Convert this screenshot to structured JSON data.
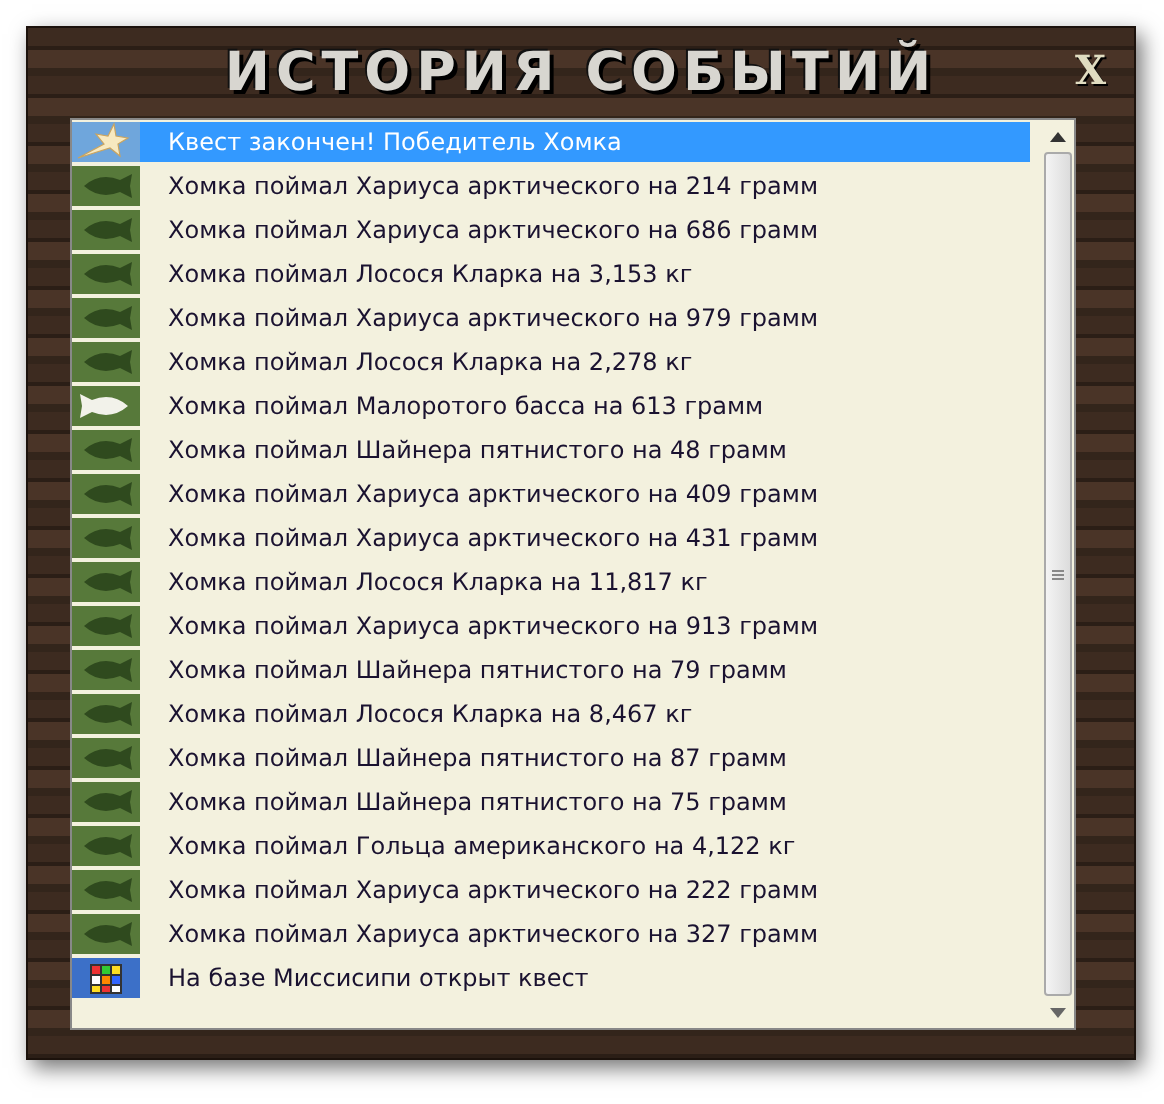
{
  "window": {
    "title": "ИСТОРИЯ СОБЫТИЙ",
    "close": "X"
  },
  "events": [
    {
      "kind": "quest_done",
      "text": "Квест закончен! Победитель Хомка",
      "selected": true
    },
    {
      "kind": "fish",
      "text": "Хомка поймал Хариуса арктического на 214 грамм",
      "selected": false
    },
    {
      "kind": "fish",
      "text": "Хомка поймал Хариуса арктического на 686 грамм",
      "selected": false
    },
    {
      "kind": "fish",
      "text": "Хомка поймал Лосося Кларка на 3,153 кг",
      "selected": false
    },
    {
      "kind": "fish",
      "text": "Хомка поймал Хариуса арктического на 979 грамм",
      "selected": false
    },
    {
      "kind": "fish",
      "text": "Хомка поймал Лосося Кларка на 2,278 кг",
      "selected": false
    },
    {
      "kind": "fish_white",
      "text": "Хомка поймал Малоротого басса на 613 грамм",
      "selected": false
    },
    {
      "kind": "fish",
      "text": "Хомка поймал Шайнера пятнистого на 48 грамм",
      "selected": false
    },
    {
      "kind": "fish",
      "text": "Хомка поймал Хариуса арктического на 409 грамм",
      "selected": false
    },
    {
      "kind": "fish",
      "text": "Хомка поймал Хариуса арктического на 431 грамм",
      "selected": false
    },
    {
      "kind": "fish",
      "text": "Хомка поймал Лосося Кларка на 11,817 кг",
      "selected": false
    },
    {
      "kind": "fish",
      "text": "Хомка поймал Хариуса арктического на 913 грамм",
      "selected": false
    },
    {
      "kind": "fish",
      "text": "Хомка поймал Шайнера пятнистого на 79 грамм",
      "selected": false
    },
    {
      "kind": "fish",
      "text": "Хомка поймал Лосося Кларка на 8,467 кг",
      "selected": false
    },
    {
      "kind": "fish",
      "text": "Хомка поймал Шайнера пятнистого на 87 грамм",
      "selected": false
    },
    {
      "kind": "fish",
      "text": "Хомка поймал Шайнера пятнистого на 75 грамм",
      "selected": false
    },
    {
      "kind": "fish",
      "text": "Хомка поймал Гольца американского на 4,122 кг",
      "selected": false
    },
    {
      "kind": "fish",
      "text": "Хомка поймал Хариуса арктического на 222 грамм",
      "selected": false
    },
    {
      "kind": "fish",
      "text": "Хомка поймал Хариуса арктического на 327 грамм",
      "selected": false
    },
    {
      "kind": "quest_open",
      "text": "На базе Миссисипи открыт квест",
      "selected": false
    }
  ]
}
